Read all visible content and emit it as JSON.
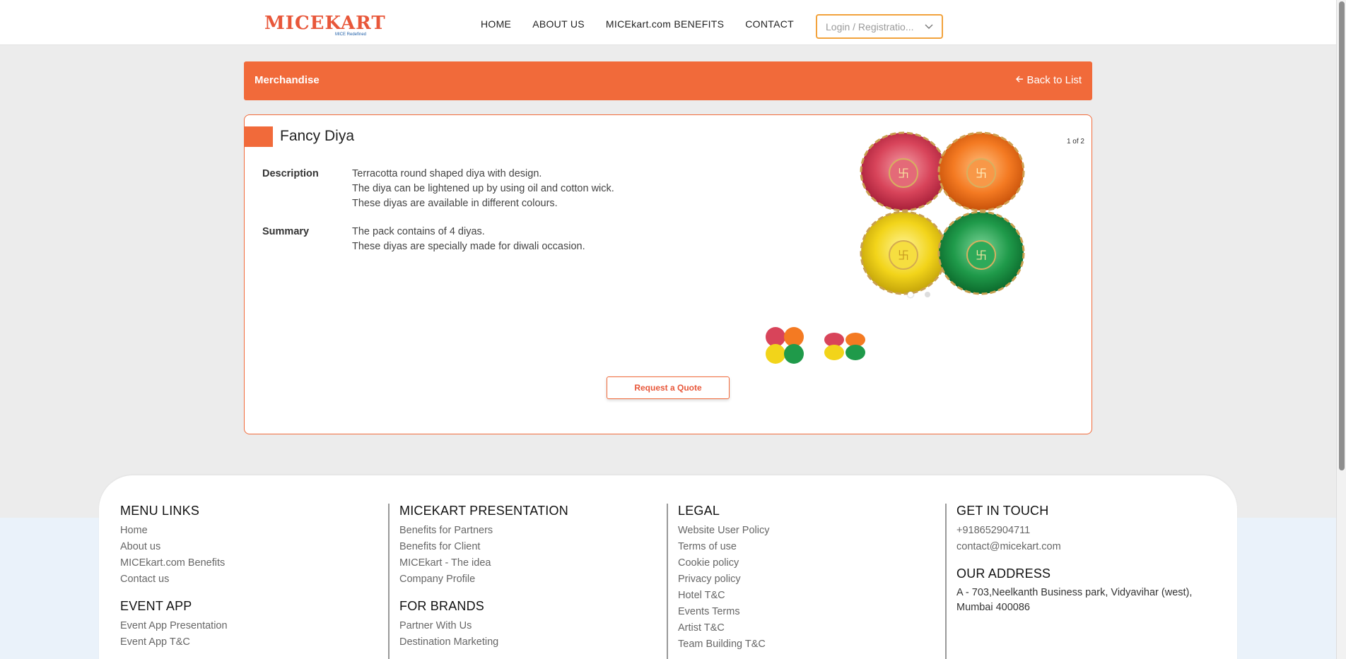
{
  "logo": {
    "text": "MICEKART",
    "tagline": "MICE Redefined"
  },
  "nav": {
    "home": "HOME",
    "about": "ABOUT US",
    "benefits": "MICEkart.com BENEFITS",
    "contact": "CONTACT"
  },
  "login": {
    "label": "Login / Registratio..."
  },
  "banner": {
    "title": "Merchandise",
    "back": "Back to List"
  },
  "product": {
    "title": "Fancy Diya",
    "description_label": "Description",
    "description": [
      "Terracotta round shaped diya with design.",
      "The diya can be lightened up by using oil and cotton wick.",
      "These diyas are available in different colours."
    ],
    "summary_label": "Summary",
    "summary": [
      "The pack contains of 4 diyas.",
      "These diyas are specially made for diwali occasion."
    ],
    "image_counter": "1 of 2",
    "quote_button": "Request a Quote"
  },
  "footer": {
    "menu_links": {
      "heading": "MENU LINKS",
      "items": [
        "Home",
        "About us",
        "MICEkart.com Benefits",
        "Contact us"
      ]
    },
    "event_app": {
      "heading": "EVENT APP",
      "items": [
        "Event App Presentation",
        "Event App T&C"
      ]
    },
    "presentation": {
      "heading": "MICEKART PRESENTATION",
      "items": [
        "Benefits for Partners",
        "Benefits for Client",
        "MICEkart - The idea",
        "Company Profile"
      ]
    },
    "brands": {
      "heading": "FOR BRANDS",
      "items": [
        "Partner With Us",
        "Destination Marketing"
      ]
    },
    "legal": {
      "heading": "LEGAL",
      "items": [
        "Website User Policy",
        "Terms of use",
        "Cookie policy",
        "Privacy policy",
        "Hotel T&C",
        "Events Terms",
        "Artist T&C",
        "Team Building T&C"
      ]
    },
    "contact": {
      "heading": "GET IN TOUCH",
      "phone": "+918652904711",
      "email": "contact@micekart.com"
    },
    "address": {
      "heading": "OUR ADDRESS",
      "text": "A - 703,Neelkanth Business park, Vidyavihar (west), Mumbai 400086"
    }
  },
  "colors": {
    "accent": "#f16a3a",
    "login_border": "#f2a23c",
    "logo_blue": "#1f5fa8"
  }
}
